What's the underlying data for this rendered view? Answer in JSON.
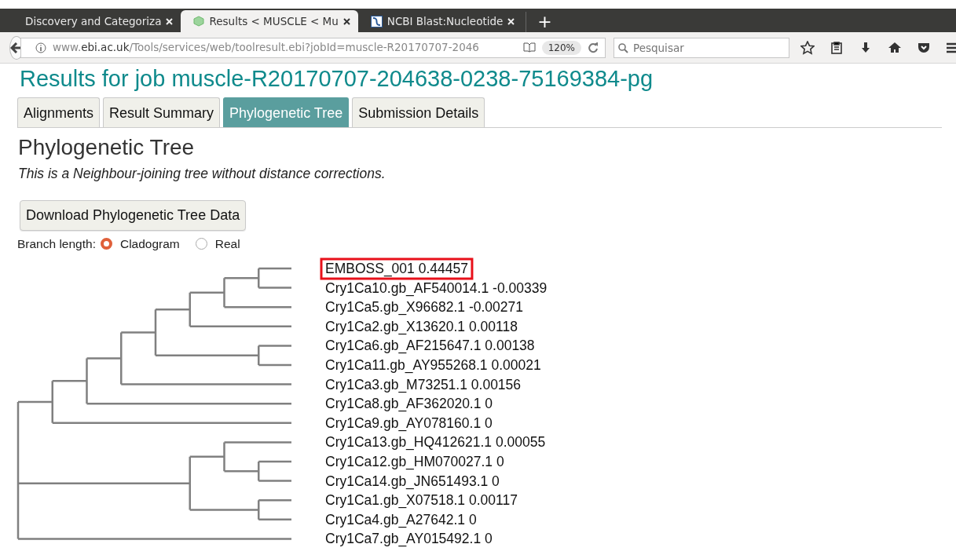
{
  "browser": {
    "tabs": [
      {
        "title": "Discovery and Categoriza",
        "kind": "plain",
        "selected": false
      },
      {
        "title": "Results < MUSCLE < Mu",
        "kind": "hexagon",
        "selected": true
      },
      {
        "title": "NCBI Blast:Nucleotide",
        "kind": "helix",
        "selected": false
      }
    ],
    "new_tab": "+",
    "url": "www.**ebi.ac.uk**/Tools/services/web/toolresult.ebi?jobId=muscle-R20170707-2046",
    "zoom": "120%",
    "search": {
      "placeholder": "Pesquisar"
    }
  },
  "page": {
    "heading": "Results for job muscle-R20170707-204638-0238-75169384-pg",
    "tabs": [
      {
        "label": "Alignments",
        "selected": false
      },
      {
        "label": "Result Summary",
        "selected": false
      },
      {
        "label": "Phylogenetic Tree",
        "selected": true
      },
      {
        "label": "Submission Details",
        "selected": false
      }
    ],
    "section_title": "Phylogenetic Tree",
    "description": "This is a Neighbour-joining tree without distance corrections.",
    "download_button": "Download Phylogenetic Tree Data",
    "branch_length": {
      "label": "Branch length:",
      "options": [
        {
          "label": "Cladogram",
          "selected": true
        },
        {
          "label": "Real",
          "selected": false
        }
      ]
    },
    "tree": {
      "children": [
        {
          "children": [
            {
              "children": [
                {
                  "children": [
                    {
                      "children": [
                        {
                          "children": [
                            {
                              "children": [
                                {
                                  "children": [
                                    {
                                      "label": "EMBOSS_001 0.44457",
                                      "highlighted": true
                                    },
                                    {
                                      "label": "Cry1Ca10.gb_AF540014.1 -0.00339",
                                      "highlighted": false
                                    }
                                  ]
                                },
                                {
                                  "label": "Cry1Ca5.gb_X96682.1 -0.00271",
                                  "highlighted": false
                                }
                              ]
                            },
                            {
                              "label": "Cry1Ca2.gb_X13620.1 0.00118",
                              "highlighted": false
                            }
                          ]
                        },
                        {
                          "children": [
                            {
                              "label": "Cry1Ca6.gb_AF215647.1 0.00138",
                              "highlighted": false
                            },
                            {
                              "label": "Cry1Ca11.gb_AY955268.1 0.00021",
                              "highlighted": false
                            }
                          ]
                        }
                      ]
                    },
                    {
                      "label": "Cry1Ca3.gb_M73251.1 0.00156",
                      "highlighted": false
                    }
                  ]
                },
                {
                  "label": "Cry1Ca8.gb_AF362020.1 0",
                  "highlighted": false
                }
              ]
            },
            {
              "label": "Cry1Ca9.gb_AY078160.1 0",
              "highlighted": false
            }
          ]
        },
        {
          "children": [
            {
              "children": [
                {
                  "label": "Cry1Ca13.gb_HQ412621.1 0.00055",
                  "highlighted": false
                },
                {
                  "children": [
                    {
                      "label": "Cry1Ca12.gb_HM070027.1 0",
                      "highlighted": false
                    },
                    {
                      "label": "Cry1Ca14.gb_JN651493.1 0",
                      "highlighted": false
                    }
                  ]
                }
              ]
            },
            {
              "children": [
                {
                  "label": "Cry1Ca1.gb_X07518.1 0.00117",
                  "highlighted": false
                },
                {
                  "label": "Cry1Ca4.gb_A27642.1 0",
                  "highlighted": false
                }
              ]
            }
          ]
        },
        {
          "label": "Cry1Ca7.gb_AY015492.1 0",
          "highlighted": false
        }
      ]
    }
  }
}
